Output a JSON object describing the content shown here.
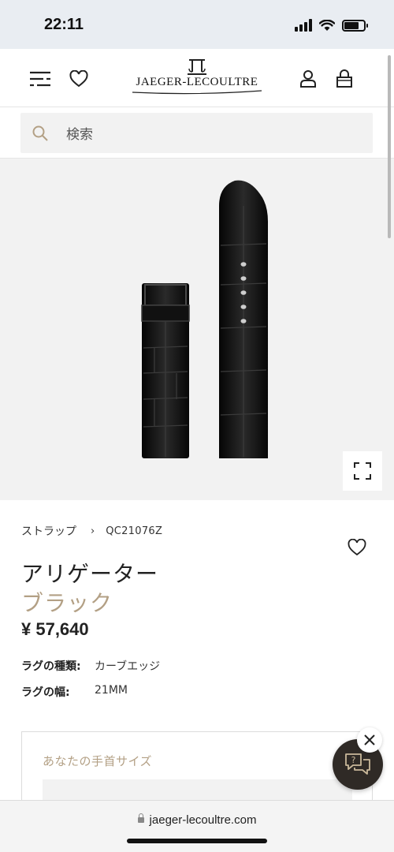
{
  "status_bar": {
    "time": "22:11"
  },
  "header": {
    "menu_icon": "menu-icon",
    "wishlist_icon": "heart-icon",
    "logo_text": "JAEGER-LECOULTRE",
    "account_icon": "user-icon",
    "bag_icon": "bag-icon"
  },
  "search": {
    "placeholder": "検索",
    "icon": "search-icon"
  },
  "product": {
    "breadcrumb": {
      "category": "ストラップ",
      "code": "QC21076Z"
    },
    "title": "アリゲーター",
    "color_name": "ブラック",
    "price": "¥ 57,640",
    "specs": [
      {
        "label": "ラグの種類:",
        "value": "カーブエッジ"
      },
      {
        "label": "ラグの幅:",
        "value": "21MM"
      }
    ]
  },
  "wrist_size": {
    "title": "あなたの手首サイズ"
  },
  "browser": {
    "url": "jaeger-lecoultre.com"
  },
  "colors": {
    "accent": "#b3a085",
    "chat_bg": "#2f2a26",
    "image_bg": "#f2f2f2"
  }
}
